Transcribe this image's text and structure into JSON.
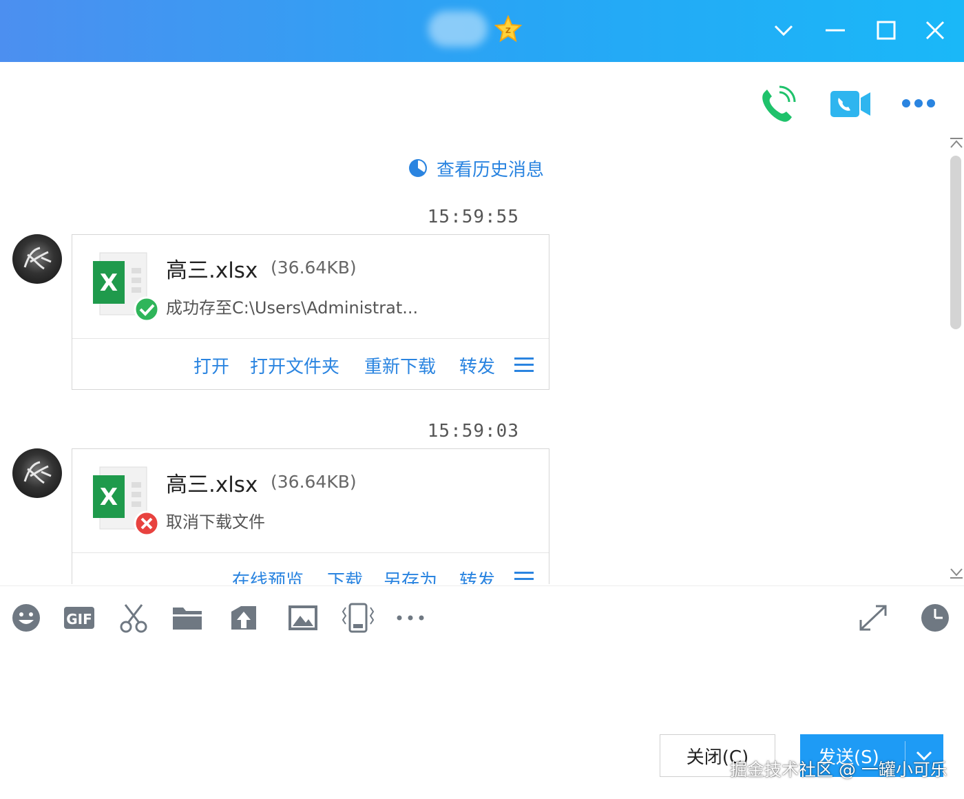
{
  "window": {
    "colors": {
      "titlebar_start": "#4c8ff0",
      "titlebar_end": "#1ab8f8",
      "accent": "#2a84e0"
    },
    "controls": [
      "chevron-down-icon",
      "minimize-icon",
      "maximize-icon",
      "close-icon"
    ]
  },
  "header_actions": [
    "voice-call-icon",
    "video-call-icon",
    "more-icon"
  ],
  "history": {
    "label": "查看历史消息"
  },
  "messages": [
    {
      "time": "15:59:55",
      "file_name": "高三.xlsx",
      "file_size": "(36.64KB)",
      "status": "成功存至C:\\Users\\Administrat...",
      "status_icon": "check-circle-icon",
      "actions": [
        "打开",
        "打开文件夹",
        "重新下载",
        "转发"
      ]
    },
    {
      "time": "15:59:03",
      "file_name": "高三.xlsx",
      "file_size": "(36.64KB)",
      "status": "取消下载文件",
      "status_icon": "error-circle-icon",
      "actions": [
        "在线预览",
        "下载",
        "另存为",
        "转发"
      ]
    }
  ],
  "toolbar": [
    "emoji-icon",
    "gif-icon",
    "screenshot-scissors-icon",
    "folder-icon",
    "send-file-icon",
    "image-icon",
    "shake-icon",
    "more-icon",
    "expand-icon",
    "history-clock-icon"
  ],
  "buttons": {
    "close": "关闭(C)",
    "send": "发送(S)"
  },
  "watermark": "掘金技术社区 @ 一罐小可乐"
}
